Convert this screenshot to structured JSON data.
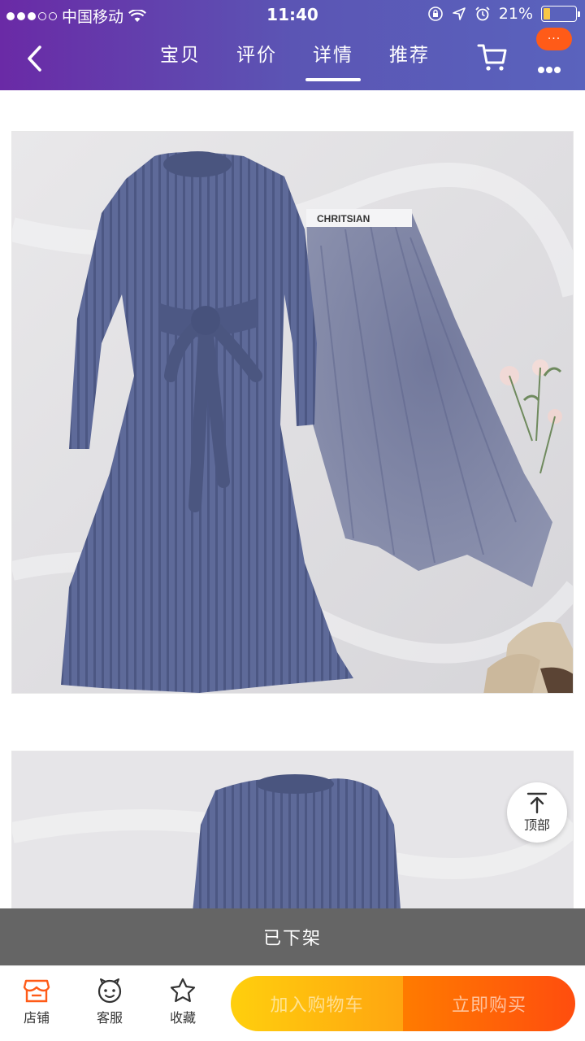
{
  "status_bar": {
    "carrier": "中国移动",
    "time": "11:40",
    "battery": "21%",
    "battery_level": 0.21,
    "signal_dots_filled": 3,
    "signal_dots_total": 5
  },
  "header": {
    "tabs": [
      {
        "label": "宝贝",
        "active": false
      },
      {
        "label": "评价",
        "active": false
      },
      {
        "label": "详情",
        "active": true
      },
      {
        "label": "推荐",
        "active": false
      }
    ],
    "more_badge": "···"
  },
  "product_photos": [
    {
      "label_tape_text": "CHRITSIAN"
    },
    {}
  ],
  "top_button": {
    "label": "顶部"
  },
  "notice": {
    "text": "已下架"
  },
  "bottom_bar": {
    "store_label": "店铺",
    "service_label": "客服",
    "favorite_label": "收藏",
    "add_to_cart_label": "加入购物车",
    "buy_now_label": "立即购买"
  },
  "colors": {
    "header_start": "#6a2aa6",
    "header_end": "#5a63bd",
    "accent_orange": "#ff5b18",
    "cart_yellow": "#ffcf0d",
    "buy_orange": "#ff4d0e"
  }
}
